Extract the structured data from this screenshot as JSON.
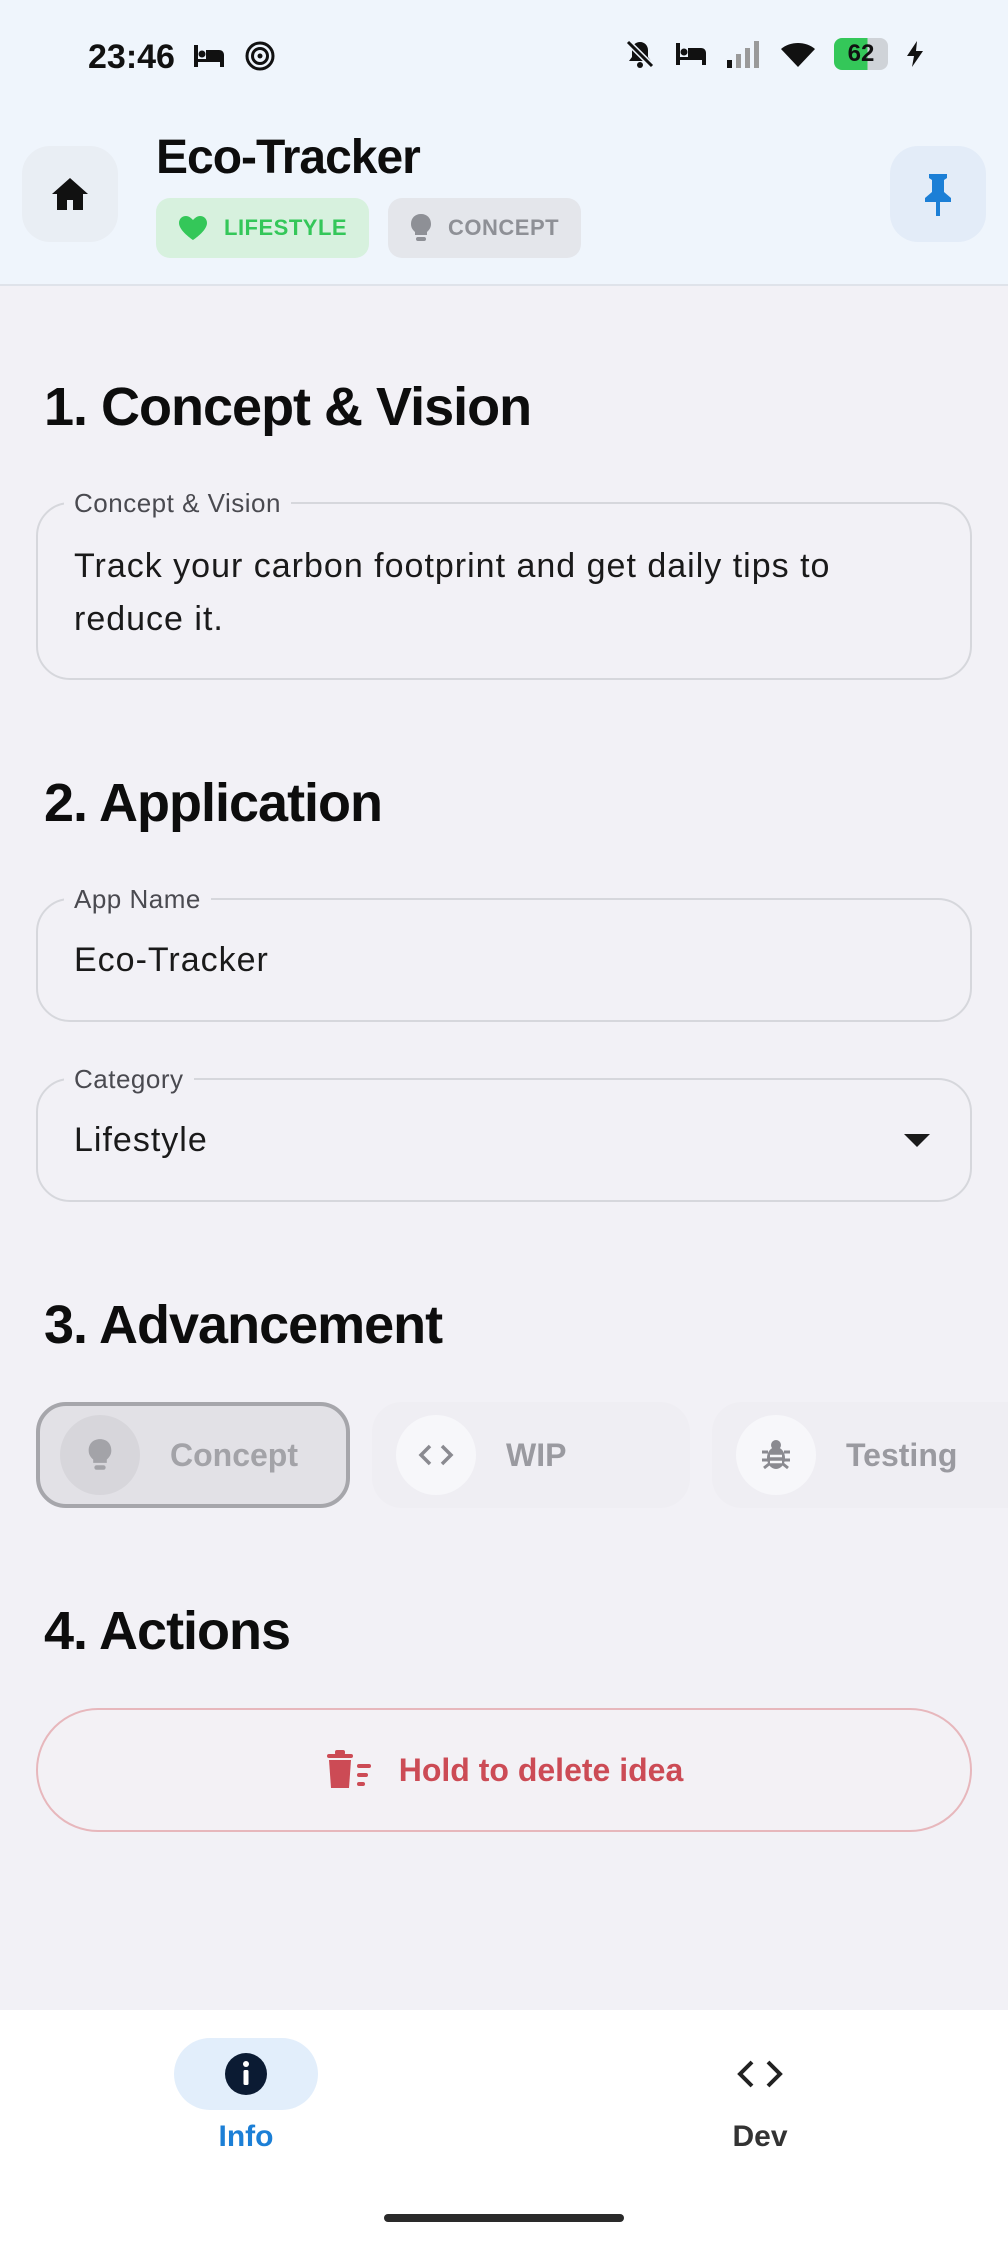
{
  "status_bar": {
    "time": "23:46",
    "battery": "62"
  },
  "header": {
    "title": "Eco-Tracker",
    "chips": [
      {
        "label": "LIFESTYLE",
        "icon": "heart-icon",
        "color": "#34c759"
      },
      {
        "label": "CONCEPT",
        "icon": "lightbulb-icon",
        "color": "#8e9096"
      }
    ]
  },
  "sections": {
    "concept": {
      "title": "1. Concept & Vision",
      "field_label": "Concept & Vision",
      "field_value": "Track your carbon footprint and get daily tips to reduce it."
    },
    "application": {
      "title": "2. Application",
      "app_name_label": "App Name",
      "app_name_value": "Eco-Tracker",
      "category_label": "Category",
      "category_value": "Lifestyle"
    },
    "advancement": {
      "title": "3. Advancement",
      "stages": [
        {
          "label": "Concept",
          "icon": "lightbulb-icon",
          "selected": true
        },
        {
          "label": "WIP",
          "icon": "code-icon",
          "selected": false
        },
        {
          "label": "Testing",
          "icon": "bug-icon",
          "selected": false
        }
      ]
    },
    "actions": {
      "title": "4. Actions",
      "delete_label": "Hold to delete idea",
      "delete_color": "#cc4b55"
    }
  },
  "bottom_nav": {
    "items": [
      {
        "label": "Info",
        "icon": "info-icon",
        "active": true
      },
      {
        "label": "Dev",
        "icon": "code-icon",
        "active": false
      }
    ],
    "accent": "#1c7fd6"
  }
}
